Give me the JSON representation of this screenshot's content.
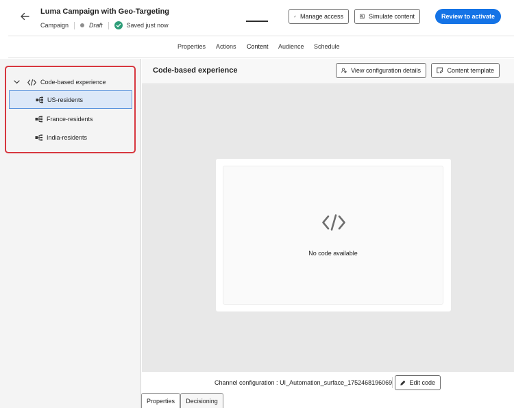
{
  "header": {
    "title": "Luma Campaign with Geo-Targeting",
    "type_label": "Campaign",
    "status": "Draft",
    "save_status": "Saved just now",
    "manage_access_label": "Manage access",
    "simulate_label": "Simulate content",
    "review_label": "Review to activate"
  },
  "tabs": [
    {
      "label": "Properties"
    },
    {
      "label": "Actions"
    },
    {
      "label": "Content"
    },
    {
      "label": "Audience"
    },
    {
      "label": "Schedule"
    }
  ],
  "active_tab": "Content",
  "tree": {
    "root_label": "Code-based experience",
    "items": [
      {
        "label": "US-residents",
        "selected": true
      },
      {
        "label": "France-residents",
        "selected": false
      },
      {
        "label": "India-residents",
        "selected": false
      }
    ]
  },
  "content": {
    "title": "Code-based experience",
    "view_config_label": "View configuration details",
    "template_label": "Content template",
    "empty_message": "No code available"
  },
  "footer": {
    "channel_text": "Channel configuration : UI_Automation_surface_1752468196069",
    "edit_code_label": "Edit code"
  },
  "bottom_tabs": [
    {
      "label": "Properties"
    },
    {
      "label": "Decisioning"
    }
  ],
  "colors": {
    "accent": "#1473e6",
    "success": "#2d9d78",
    "highlight_border": "#d7373f",
    "selected_bg": "#dce8f8"
  }
}
